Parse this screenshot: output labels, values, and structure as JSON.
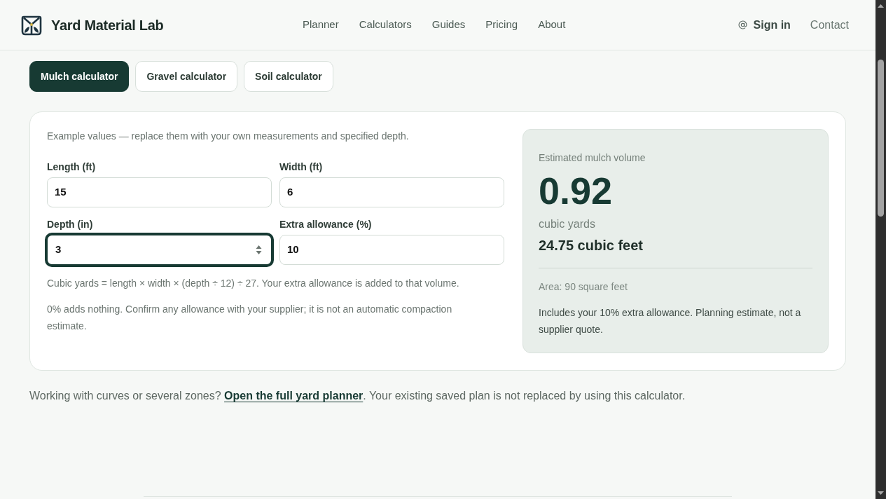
{
  "header": {
    "brand": "Yard Material Lab",
    "nav": [
      {
        "label": "Planner"
      },
      {
        "label": "Calculators"
      },
      {
        "label": "Guides"
      },
      {
        "label": "Pricing"
      },
      {
        "label": "About"
      }
    ],
    "sign_in": "Sign in",
    "contact": "Contact"
  },
  "tabs": [
    {
      "label": "Mulch calculator",
      "selected": true
    },
    {
      "label": "Gravel calculator",
      "selected": false
    },
    {
      "label": "Soil calculator",
      "selected": false
    }
  ],
  "calculator": {
    "intro": "Example values — replace them with your own measurements and specified depth.",
    "fields": [
      {
        "label": "Length (ft)",
        "value": "15",
        "focused": false
      },
      {
        "label": "Width (ft)",
        "value": "6",
        "focused": false
      },
      {
        "label": "Depth (in)",
        "value": "3",
        "focused": true
      },
      {
        "label": "Extra allowance (%)",
        "value": "10",
        "focused": false
      }
    ],
    "formula": "Cubic yards = length × width × (depth ÷ 12) ÷ 27. Your extra allowance is added to that volume.",
    "note": "0% adds nothing. Confirm any allowance with your supplier; it is not an automatic compaction estimate."
  },
  "result": {
    "title": "Estimated mulch volume",
    "value": "0.92",
    "unit": "cubic yards",
    "secondary": "24.75 cubic feet",
    "area": "Area: 90 square feet",
    "note": "Includes your 10% extra allowance. Planning estimate, not a supplier quote."
  },
  "footer_note": {
    "before": "Working with curves or several zones? ",
    "link": "Open the full yard planner",
    "after": ". Your existing saved plan is not replaced by using this calculator."
  }
}
